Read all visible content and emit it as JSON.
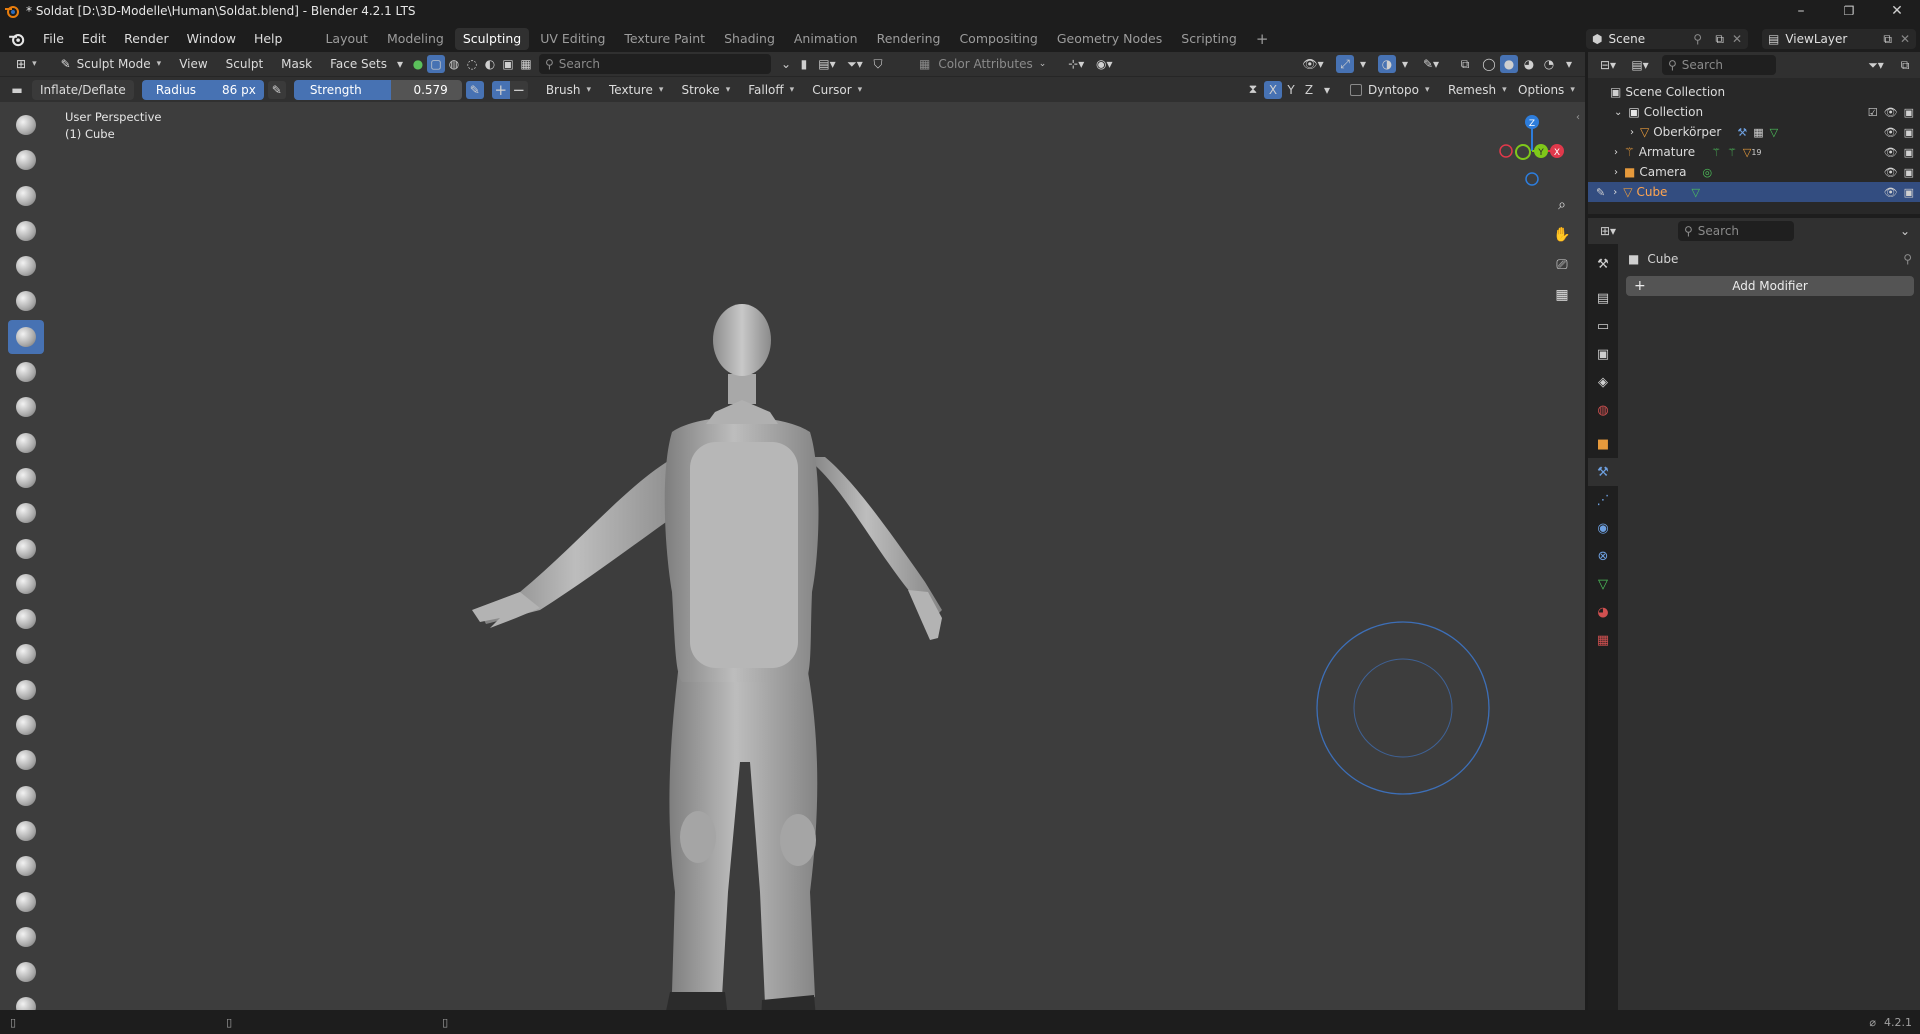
{
  "window": {
    "title": "* Soldat [D:\\3D-Modelle\\Human\\Soldat.blend] - Blender 4.2.1 LTS",
    "controls": {
      "minimize": "–",
      "maximize": "❐",
      "close": "✕"
    }
  },
  "menu": {
    "items": [
      "File",
      "Edit",
      "Render",
      "Window",
      "Help"
    ]
  },
  "workspaces": {
    "tabs": [
      "Layout",
      "Modeling",
      "Sculpting",
      "UV Editing",
      "Texture Paint",
      "Shading",
      "Animation",
      "Rendering",
      "Compositing",
      "Geometry Nodes",
      "Scripting"
    ],
    "active": "Sculpting",
    "add": "+"
  },
  "scene": {
    "name": "Scene",
    "view_layer": "ViewLayer"
  },
  "viewport_header": {
    "mode": "Sculpt Mode",
    "menus": [
      "View",
      "Sculpt",
      "Mask",
      "Face Sets"
    ],
    "search_placeholder": "Search",
    "color_attributes": "Color Attributes"
  },
  "tool_header": {
    "brush_name": "Inflate/Deflate",
    "radius_label": "Radius",
    "radius_value": "86 px",
    "strength_label": "Strength",
    "strength_value": "0.579",
    "strength_fraction": 0.579,
    "add": "+",
    "subtract": "−",
    "menus": [
      "Brush",
      "Texture",
      "Stroke",
      "Falloff",
      "Cursor"
    ],
    "axes": [
      "X",
      "Y",
      "Z"
    ],
    "dyntopo": "Dyntopo",
    "remesh": "Remesh",
    "options": "Options"
  },
  "viewport": {
    "perspective": "User Perspective",
    "object": "(1) Cube",
    "gizmo_axes": {
      "x": "X",
      "y": "Y",
      "z": "Z"
    },
    "colors": {
      "x": "#e0394b",
      "y": "#7fc81a",
      "z": "#2d7ddc",
      "background": "#3d3d3d",
      "brush_cursor": "#3d6fb8"
    }
  },
  "outliner": {
    "search_placeholder": "Search",
    "root": "Scene Collection",
    "collection": "Collection",
    "objects": [
      {
        "name": "Oberkörper",
        "icon": "mesh-icon",
        "selected": false
      },
      {
        "name": "Armature",
        "icon": "armature-icon",
        "selected": false,
        "badge": "19"
      },
      {
        "name": "Camera",
        "icon": "camera-icon",
        "selected": false
      },
      {
        "name": "Cube",
        "icon": "mesh-icon",
        "selected": true
      }
    ]
  },
  "properties": {
    "search_placeholder": "Search",
    "object_name": "Cube",
    "add_modifier": "Add Modifier",
    "add_icon": "+"
  },
  "statusbar": {
    "version": "4.2.1"
  }
}
